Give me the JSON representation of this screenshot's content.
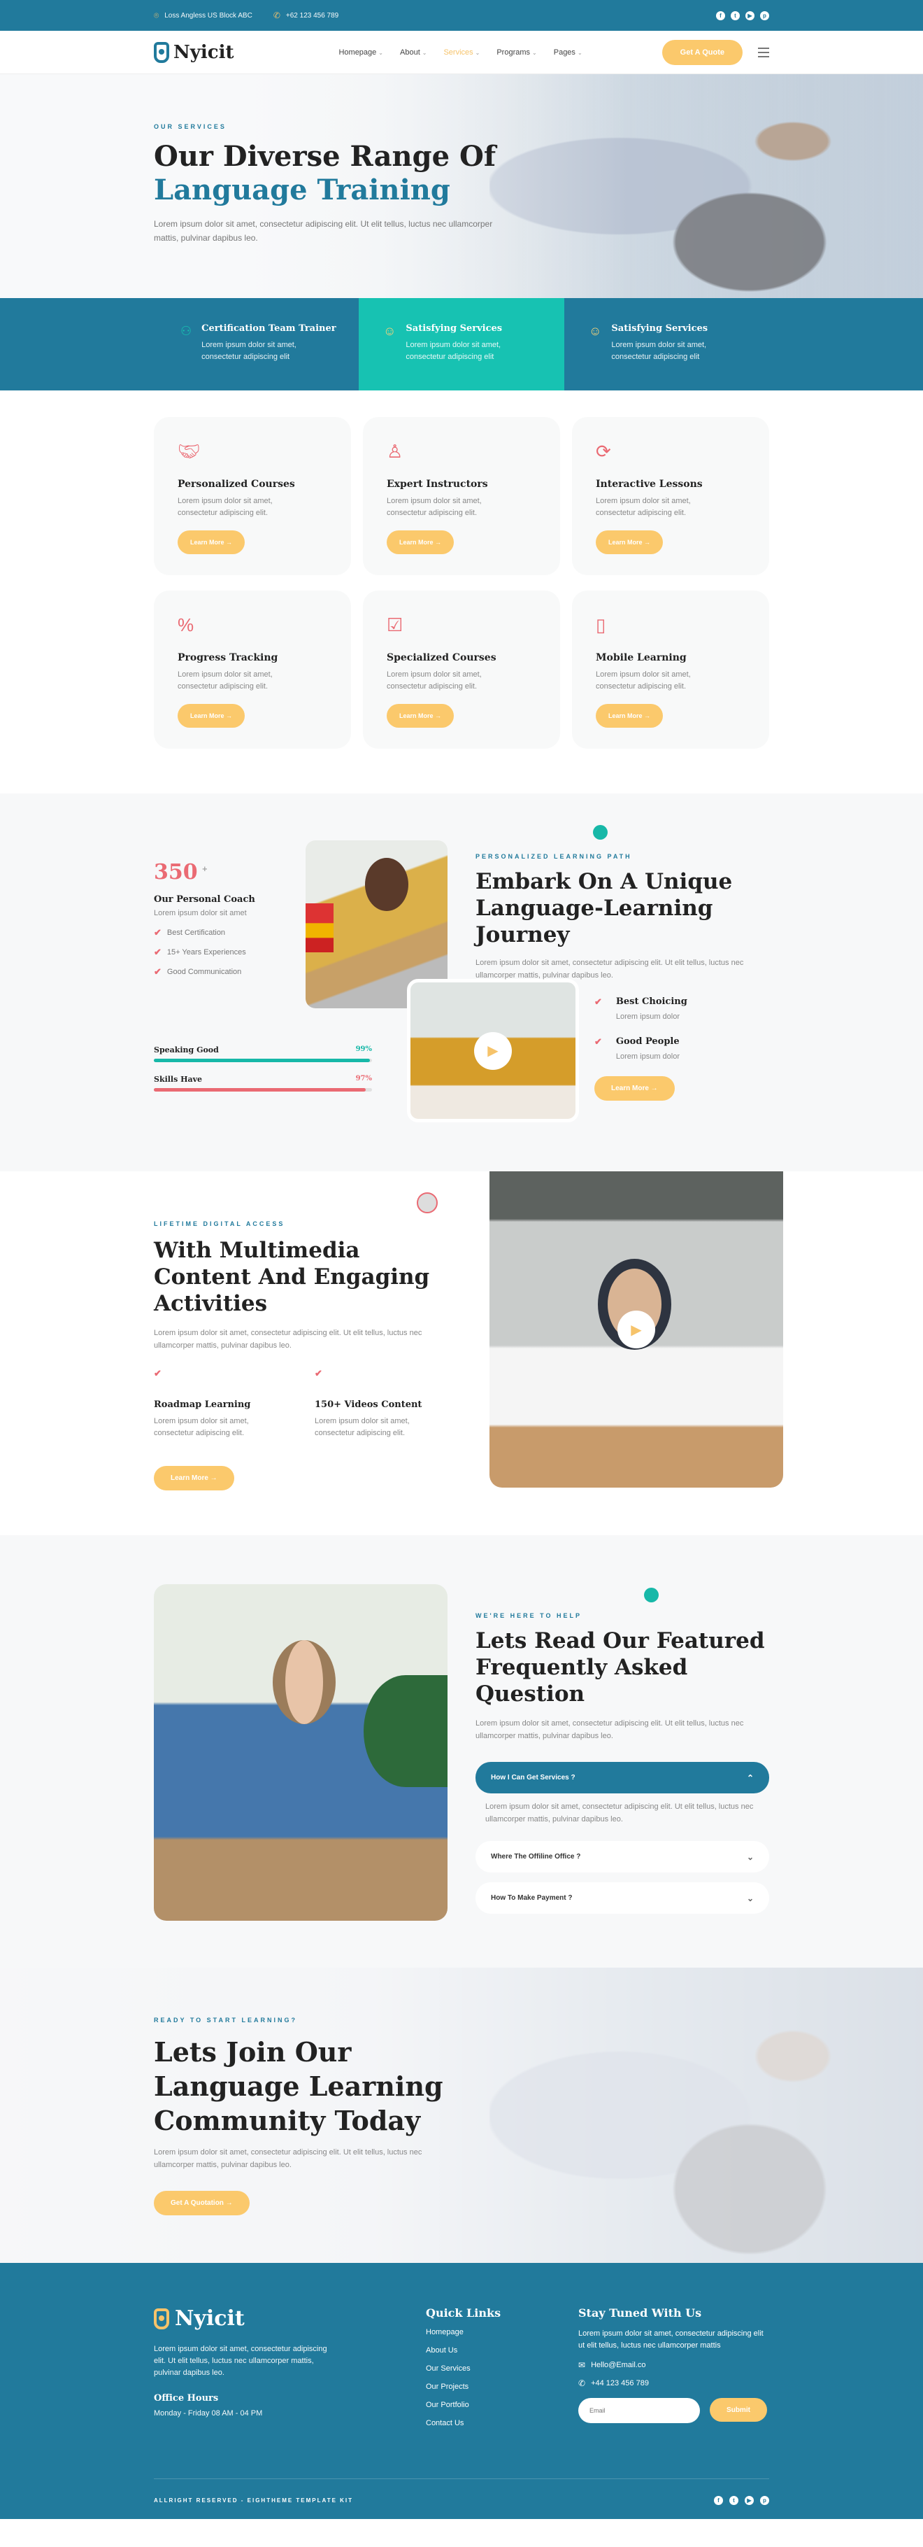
{
  "topbar": {
    "address": "Loss Angless US Block ABC",
    "phone": "+62 123 456 789",
    "socials": [
      "facebook-icon",
      "twitter-icon",
      "youtube-icon",
      "pinterest-icon"
    ]
  },
  "nav": {
    "brand": "Nyicit",
    "items": [
      {
        "label": "Homepage",
        "active": false
      },
      {
        "label": "About",
        "active": false
      },
      {
        "label": "Services",
        "active": true
      },
      {
        "label": "Programs",
        "active": false
      },
      {
        "label": "Pages",
        "active": false
      }
    ],
    "cta": "Get A Quote"
  },
  "hero": {
    "eyebrow": "OUR SERVICES",
    "title_line1": "Our Diverse Range Of",
    "title_line2": "Language Training",
    "text": "Lorem ipsum dolor sit amet, consectetur adipiscing elit. Ut elit tellus, luctus nec ullamcorper mattis, pulvinar dapibus leo."
  },
  "strip": [
    {
      "icon": "users-icon",
      "title": "Certification Team Trainer",
      "text": "Lorem ipsum dolor sit amet, consectetur adipiscing elit"
    },
    {
      "icon": "smile-icon",
      "title": "Satisfying Services",
      "text": "Lorem ipsum dolor sit amet, consectetur adipiscing elit"
    },
    {
      "icon": "smile-icon",
      "title": "Satisfying Services",
      "text": "Lorem ipsum dolor sit amet, consectetur adipiscing elit"
    }
  ],
  "services": [
    {
      "icon": "handshake-icon",
      "title": "Personalized Courses",
      "text": "Lorem ipsum dolor sit amet, consectetur adipiscing elit.",
      "button": "Learn More →"
    },
    {
      "icon": "instructor-stars-icon",
      "title": "Expert Instructors",
      "text": "Lorem ipsum dolor sit amet, consectetur adipiscing elit.",
      "button": "Learn More →"
    },
    {
      "icon": "user-refresh-icon",
      "title": "Interactive Lessons",
      "text": "Lorem ipsum dolor sit amet, consectetur adipiscing elit.",
      "button": "Learn More →"
    },
    {
      "icon": "progress-icon",
      "title": "Progress Tracking",
      "text": "Lorem ipsum dolor sit amet, consectetur adipiscing elit.",
      "button": "Learn More →"
    },
    {
      "icon": "user-check-icon",
      "title": "Specialized Courses",
      "text": "Lorem ipsum dolor sit amet, consectetur adipiscing elit.",
      "button": "Learn More →"
    },
    {
      "icon": "mobile-chat-icon",
      "title": "Mobile Learning",
      "text": "Lorem ipsum dolor sit amet, consectetur adipiscing elit.",
      "button": "Learn More →"
    }
  ],
  "journey": {
    "stat_number": "350",
    "stat_suffix": "+",
    "coach_title": "Our Personal Coach",
    "coach_sub": "Lorem ipsum dolor sit amet",
    "checks": [
      "Best Certification",
      "15+ Years Experiences",
      "Good Communication"
    ],
    "skills": [
      {
        "label": "Speaking Good",
        "pct_text": "99%",
        "value": 99,
        "color": "#17b8a8"
      },
      {
        "label": "Skills Have",
        "pct_text": "97%",
        "value": 97,
        "color": "#ea6a73"
      }
    ],
    "eyebrow": "PERSONALIZED LEARNING PATH",
    "title": "Embark On A Unique Language-Learning Journey",
    "text": "Lorem ipsum dolor sit amet, consectetur adipiscing elit. Ut elit tellus, luctus nec ullamcorper mattis, pulvinar dapibus leo.",
    "points": [
      {
        "title": "Best Choicing",
        "text": "Lorem ipsum dolor"
      },
      {
        "title": "Good People",
        "text": "Lorem ipsum dolor"
      }
    ],
    "button": "Learn More →"
  },
  "multimedia": {
    "eyebrow": "LIFETIME DIGITAL ACCESS",
    "title": "With Multimedia Content And Engaging Activities",
    "text": "Lorem ipsum dolor sit amet, consectetur adipiscing elit. Ut elit tellus, luctus nec ullamcorper mattis, pulvinar dapibus leo.",
    "features": [
      {
        "title": "Roadmap Learning",
        "text": "Lorem ipsum dolor sit amet, consectetur adipiscing elit."
      },
      {
        "title": "150+ Videos Content",
        "text": "Lorem ipsum dolor sit amet, consectetur adipiscing elit."
      }
    ],
    "button": "Learn More →"
  },
  "faq": {
    "eyebrow": "WE'RE HERE TO HELP",
    "title": "Lets Read Our Featured Frequently Asked Question",
    "text": "Lorem ipsum dolor sit amet, consectetur adipiscing elit. Ut elit tellus, luctus nec ullamcorper mattis, pulvinar dapibus leo.",
    "items": [
      {
        "q": "How I Can Get Services ?",
        "open": true,
        "a": "Lorem ipsum dolor sit amet, consectetur adipiscing elit. Ut elit tellus, luctus nec ullamcorper mattis, pulvinar dapibus leo."
      },
      {
        "q": "Where The Offiline Office ?",
        "open": false
      },
      {
        "q": "How To Make Payment ?",
        "open": false
      }
    ]
  },
  "cta": {
    "eyebrow": "READY TO START LEARNING?",
    "title": "Lets Join Our Language Learning Community Today",
    "text": "Lorem ipsum dolor sit amet, consectetur adipiscing elit. Ut elit tellus, luctus nec ullamcorper mattis, pulvinar dapibus leo.",
    "button": "Get A Quotation →"
  },
  "footer": {
    "brand": "Nyicit",
    "about": "Lorem ipsum dolor sit amet, consectetur adipiscing elit. Ut elit tellus, luctus nec ullamcorper mattis, pulvinar dapibus leo.",
    "hours_title": "Office Hours",
    "hours": "Monday - Friday 08 AM - 04 PM",
    "links_title": "Quick Links",
    "links": [
      "Homepage",
      "About Us",
      "Our Services",
      "Our Projects",
      "Our Portfolio",
      "Contact Us"
    ],
    "newsletter_title": "Stay Tuned With Us",
    "newsletter_text": "Lorem ipsum dolor sit amet, consectetur adipiscing elit ut elit tellus, luctus nec ullamcorper mattis",
    "email": "Hello@Email.co",
    "phone": "+44 123 456 789",
    "email_placeholder": "Email",
    "submit": "Submit",
    "copyright": "ALLRIGHT RESERVED - EIGHTHEME TEMPLATE KIT"
  },
  "colors": {
    "primary": "#217a9c",
    "teal": "#17c2b2",
    "accent_yellow": "#fbc96c",
    "accent_red": "#ea6a73"
  }
}
